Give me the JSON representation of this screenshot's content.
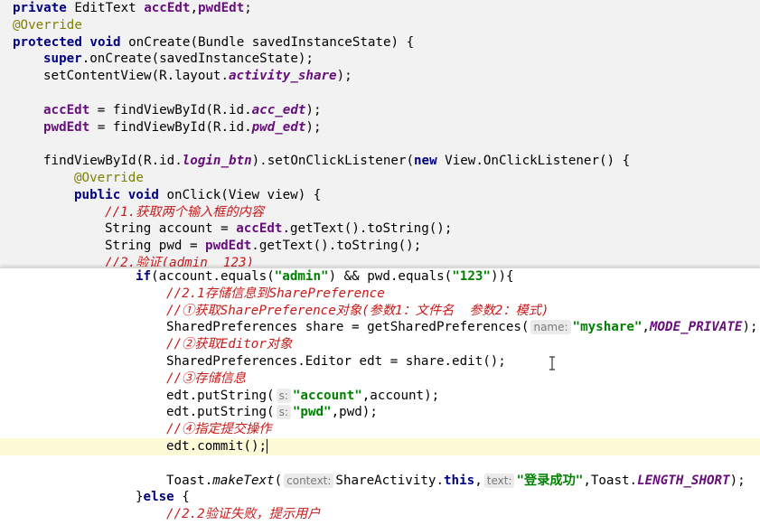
{
  "code": {
    "l1_kw": "private",
    "l1_type": " EditText ",
    "l1_f1": "accEdt",
    "l1_comma": ",",
    "l1_f2": "pwdEdt",
    "l1_end": ";",
    "l2_ann": "@Override",
    "l3_kw1": "protected",
    "l3_kw2": "void",
    "l3_rest": " onCreate(Bundle savedInstanceState) {",
    "l4_kw": "super",
    "l4_rest": ".onCreate(savedInstanceState);",
    "l5_a": "setContentView(R.layout.",
    "l5_f": "activity_share",
    "l5_b": ");",
    "l7_f": "accEdt",
    "l7_a": " = findViewById(R.id.",
    "l7_id": "acc_edt",
    "l7_b": ");",
    "l8_f": "pwdEdt",
    "l8_a": " = findViewById(R.id.",
    "l8_id": "pwd_edt",
    "l8_b": ");",
    "l10_a": "findViewById(R.id.",
    "l10_id": "login_btn",
    "l10_b": ").setOnClickListener(",
    "l10_kw": "new",
    "l10_c": " View.OnClickListener() {",
    "l11_ann": "@Override",
    "l12_kw1": "public",
    "l12_kw2": "void",
    "l12_rest": " onClick(View view) {",
    "l13_cmt": "//1.获取两个输入框的内容",
    "l14_a": "String account = ",
    "l14_f": "accEdt",
    "l14_b": ".getText().toString();",
    "l15_a": "String pwd = ",
    "l15_f": "pwdEdt",
    "l15_b": ".getText().toString();",
    "l16_cmt": "//2.验证(admin  123)",
    "b1_kw": "if",
    "b1_a": "(account.equals(",
    "b1_s1": "\"admin\"",
    "b1_b": ") && pwd.equals(",
    "b1_s2": "\"123\"",
    "b1_c": ")){",
    "b2_cmt": "//2.1存储信息到SharePreference",
    "b3_cmt": "//①获取SharePreference对象(参数1：文件名  参数2：模式)",
    "b4_a": "SharedPreferences share = getSharedPreferences(",
    "b4_hint": "name:",
    "b4_s": "\"myshare\"",
    "b4_comma": ",",
    "b4_const": "MODE_PRIVATE",
    "b4_end": ");",
    "b5_cmt": "//②获取Editor对象",
    "b6_a": "SharedPreferences.Editor edt = share.edit();",
    "b7_cmt": "//③存储信息",
    "b8_a": "edt.putString(",
    "b8_hint": "s:",
    "b8_s": "\"account\"",
    "b8_b": ",account);",
    "b9_a": "edt.putString(",
    "b9_hint": "s:",
    "b9_s": "\"pwd\"",
    "b9_b": ",pwd);",
    "b10_cmt": "//④指定提交操作",
    "b11_a": "edt.commit();",
    "b13_a": "Toast.",
    "b13_m": "makeText",
    "b13_b": "(",
    "b13_hint1": "context:",
    "b13_c": "ShareActivity.",
    "b13_kw": "this",
    "b13_d": ",",
    "b13_hint2": "text:",
    "b13_s": "\"登录成功\"",
    "b13_e": ",Toast.",
    "b13_const": "LENGTH_SHORT",
    "b13_end": ");",
    "b14_a": "}",
    "b14_kw": "else",
    "b14_b": " {",
    "b15_cmt": "//2.2验证失败，提示用户"
  },
  "colors": {
    "keyword": "#000080",
    "annotation": "#808000",
    "field": "#660e7a",
    "string": "#008000",
    "comment": "#808080",
    "todo_comment": "#c71a1a",
    "caret_line": "#fcfad7"
  },
  "icons": {
    "cursor": "ibeam-cursor-icon"
  }
}
